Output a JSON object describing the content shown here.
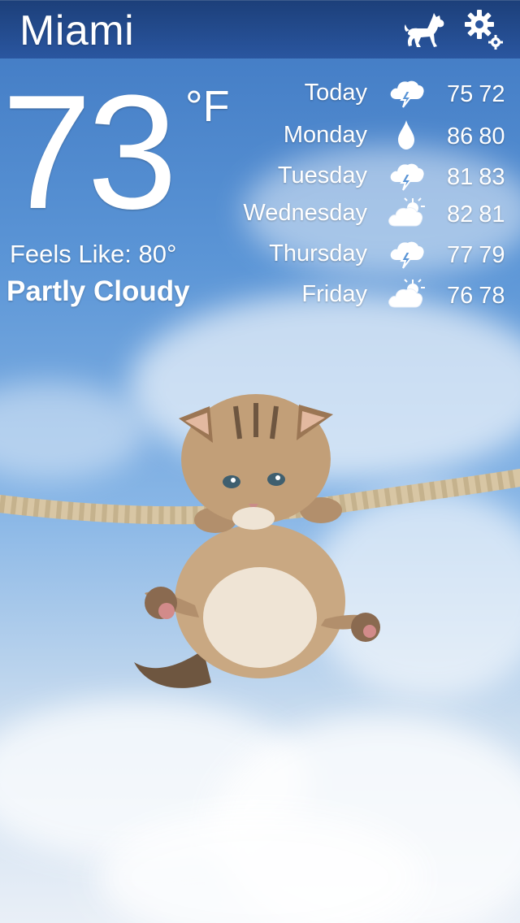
{
  "header": {
    "city": "Miami",
    "dog_icon": "dog-icon",
    "gear_icon": "gear-icon"
  },
  "current": {
    "temperature": "73",
    "unit": "°F",
    "feels_like_label": "Feels Like:",
    "feels_like_value": "80°",
    "condition": "Partly Cloudy"
  },
  "forecast": [
    {
      "day": "Today",
      "icon": "thunderstorm-icon",
      "high": "75",
      "low": "72"
    },
    {
      "day": "Monday",
      "icon": "raindrop-icon",
      "high": "86",
      "low": "80"
    },
    {
      "day": "Tuesday",
      "icon": "thunderstorm-icon",
      "high": "81",
      "low": "83"
    },
    {
      "day": "Wednesday",
      "icon": "partly-cloudy-icon",
      "high": "82",
      "low": "81"
    },
    {
      "day": "Thursday",
      "icon": "thunderstorm-icon",
      "high": "77",
      "low": "79"
    },
    {
      "day": "Friday",
      "icon": "partly-cloudy-icon",
      "high": "76",
      "low": "78"
    }
  ],
  "colors": {
    "header": "#1c3f79",
    "sky": "#5b95d6",
    "text": "#ffffff"
  }
}
